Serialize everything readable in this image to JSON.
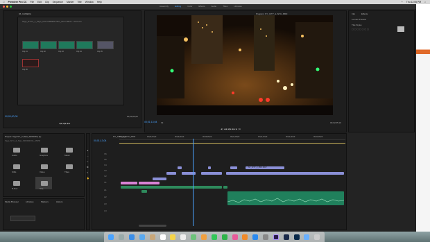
{
  "menubar": {
    "app_name": "Premiere Pro CC",
    "items": [
      "File",
      "Edit",
      "Clip",
      "Sequence",
      "Marker",
      "Title",
      "Window",
      "Help"
    ],
    "clock": "Thu 12:55 PM"
  },
  "workspaces": [
    "Assembly",
    "Editing",
    "Color",
    "Effects",
    "Audio",
    "Titles",
    "Libraries"
  ],
  "active_workspace": "Editing",
  "source_panel": {
    "tab": "06_CAMERA",
    "path": "Tags_NYC2_1_Tago_Old SCREEN PRO_00-12.MOV - 53 Items",
    "timecode_left": "00;00;00;00",
    "timecode_right": "00;00;00;00",
    "thumb_labels": [
      "Clip 01",
      "Clip 02",
      "Clip 03",
      "Clip 04",
      "Clip 05",
      "Clip 06"
    ]
  },
  "program_panel": {
    "tab": "Program: NY_CITY_1_NYC_PRO",
    "timecode_left": "00;01;13;04",
    "fit": "Fit",
    "timecode_right": "00;02;05;10"
  },
  "effects_panel": {
    "tabs": [
      "Info",
      "Effects"
    ],
    "heading": "Lumetri Presets",
    "sub": "Title Styles"
  },
  "project_panel": {
    "tab": "Project: Tags NY_2 (Stat_SRXDRV) (1)",
    "path": "Tags_NY1_2_Stat_SRXDRV01_25PM",
    "folder_labels": [
      "Audio",
      "Graphics",
      "Music",
      "Stills",
      "Video",
      "Titles",
      "B-Roll",
      "Seq"
    ]
  },
  "media_browser": {
    "tabs": [
      "Media Browser",
      "Libraries",
      "Markers",
      "History"
    ]
  },
  "timeline": {
    "tab": "NY_CITY_1_NYC_PRO",
    "timecode": "00;01;13;04",
    "ruler_ticks": [
      "00;00;00",
      "00;00;15;00",
      "00;00;30;00",
      "00;00;45;00",
      "00;01;00;00",
      "00;01;15;00",
      "00;01;30;00",
      "00;01;45;00",
      "00;02;00;00"
    ],
    "video_tracks": [
      "V6",
      "V5",
      "V4",
      "V3",
      "V2",
      "V1"
    ],
    "audio_tracks": [
      "A1",
      "A2",
      "A3",
      "A4"
    ],
    "clip_label": "NY_CITY_2_PRO.MOV"
  },
  "colors": {
    "accent": "#4aa3ff",
    "video_clip": "#8a8fd6",
    "pink_clip": "#d983d6",
    "green_clip": "#2e8a5c",
    "audio_clip": "#20805c"
  }
}
